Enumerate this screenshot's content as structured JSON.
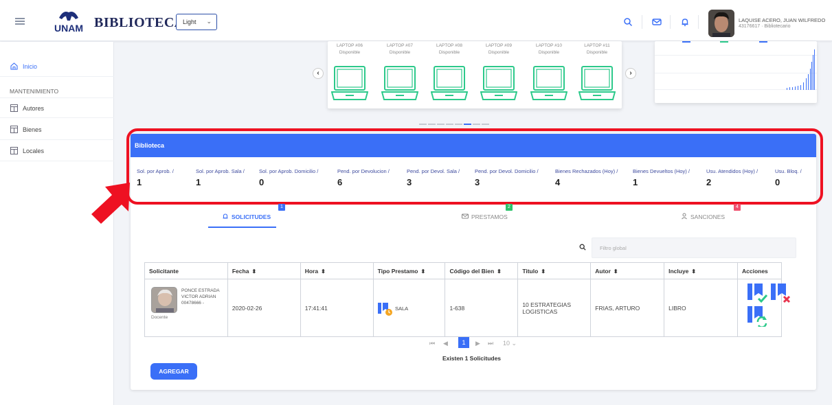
{
  "header": {
    "brand": "BIBLIOTECA",
    "logo_text": "UNAM",
    "theme_select": "Light",
    "user_name": "LAQUISE ACERO, JUAN WILFREDO",
    "user_sub": "43176617 · Bibliotecario"
  },
  "sidebar": {
    "section": "MANTENIMIENTO",
    "items": [
      {
        "label": "Inicio",
        "icon": "home-icon"
      },
      {
        "label": "Autores",
        "icon": "table-icon"
      },
      {
        "label": "Bienes",
        "icon": "table-icon"
      },
      {
        "label": "Locales",
        "icon": "table-icon"
      }
    ]
  },
  "carousel": {
    "items": [
      {
        "title": "LAPTOP #06",
        "status": "Disponible"
      },
      {
        "title": "LAPTOP #07",
        "status": "Disponible"
      },
      {
        "title": "LAPTOP #08",
        "status": "Disponible"
      },
      {
        "title": "LAPTOP #09",
        "status": "Disponible"
      },
      {
        "title": "LAPTOP #10",
        "status": "Disponible"
      },
      {
        "title": "LAPTOP #11",
        "status": "Disponible"
      }
    ],
    "prev": "‹",
    "next": "›",
    "dot_count": 8,
    "active_dot": 5
  },
  "card": {
    "title": "Biblioteca",
    "stats": [
      {
        "label": "Sol. por Aprob. /",
        "value": "1"
      },
      {
        "label": "Sol. por Aprob. Sala /",
        "value": "1"
      },
      {
        "label": "Sol. por Aprob. Domicilio /",
        "value": "0"
      },
      {
        "label": "Pend. por Devolucion /",
        "value": "6"
      },
      {
        "label": "Pend. por Devol. Sala /",
        "value": "3"
      },
      {
        "label": "Pend. por Devol. Domicilio /",
        "value": "3"
      },
      {
        "label": "Bienes Rechazados (Hoy) /",
        "value": "4"
      },
      {
        "label": "Bienes Devueltos (Hoy) /",
        "value": "1"
      },
      {
        "label": "Usu. Atendidos (Hoy) /",
        "value": "2"
      },
      {
        "label": "Usu. Bloq. /",
        "value": "0"
      }
    ]
  },
  "tabs": [
    {
      "label": "SOLICITUDES",
      "badge": "1",
      "badge_color": "#3a6ff7"
    },
    {
      "label": "PRESTAMOS",
      "badge": "2",
      "badge_color": "#2bc36b"
    },
    {
      "label": "SANCIONES",
      "badge": "4",
      "badge_color": "#f0506e"
    }
  ],
  "filter": {
    "placeholder": "Filtro global"
  },
  "table": {
    "headers": [
      "Solicitante",
      "Fecha",
      "Hora",
      "Tipo Prestamo",
      "Código del Bien",
      "Titulo",
      "Autor",
      "Incluye",
      "Acciones"
    ],
    "row": {
      "name1": "PONCE ESTRADA",
      "name2": "VICTOR ADRIAN",
      "code": "00478666 -",
      "role": "Docente",
      "fecha": "2020-02-26",
      "hora": "17:41:41",
      "tipo": "SALA",
      "codigo": "1-638",
      "titulo1": "10 ESTRATEGIAS",
      "titulo2": "LOGISTICAS",
      "autor": "FRIAS, ARTURO",
      "incluye": "LIBRO"
    }
  },
  "pagination": {
    "page": "1",
    "per_page": "10"
  },
  "total_text": "Existen 1 Solicitudes",
  "add_button": "AGREGAR",
  "colors": {
    "primary": "#3a6ff7",
    "highlight": "#ee1122",
    "laptop": "#2bc98a"
  }
}
